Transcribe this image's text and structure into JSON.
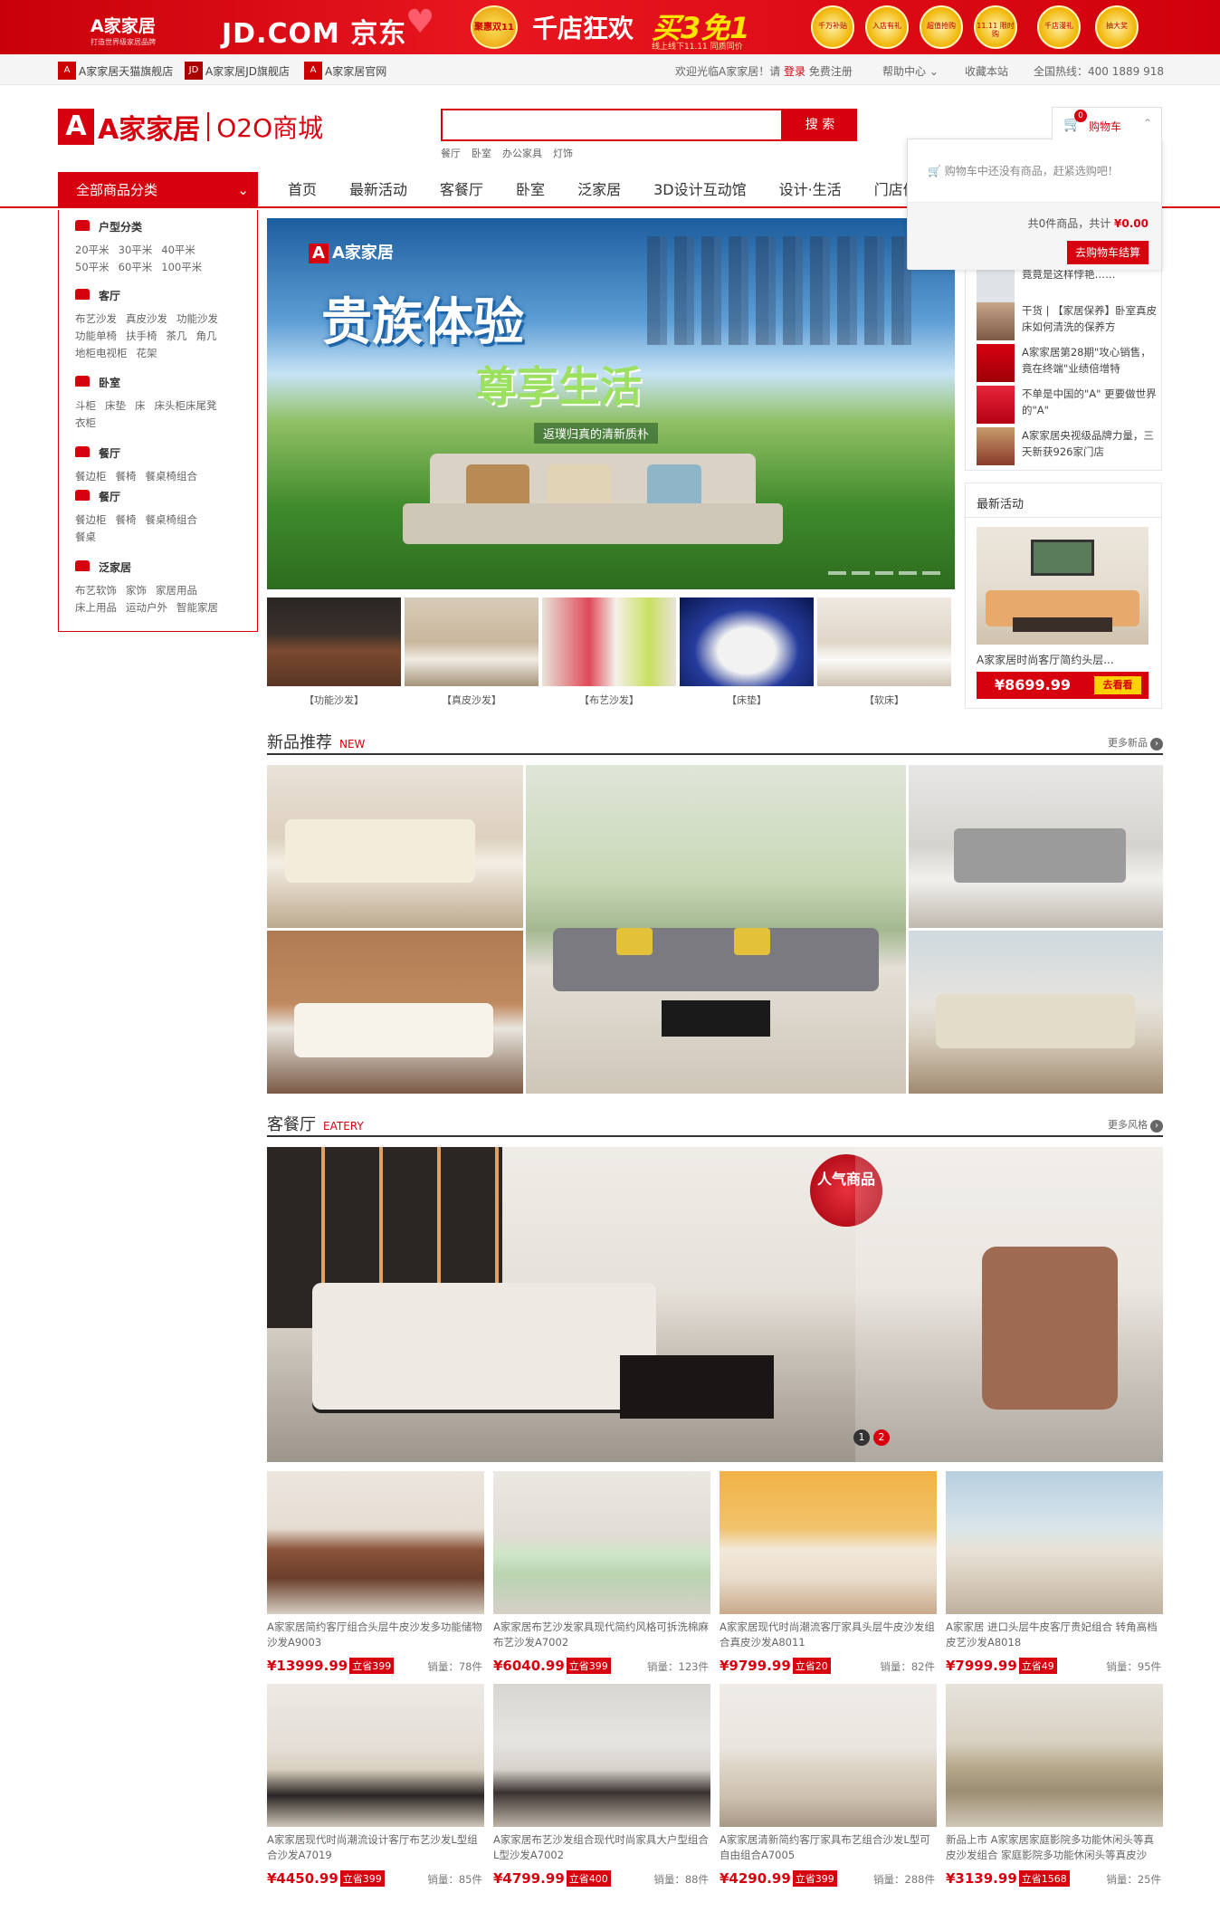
{
  "promo": {
    "brand": "A家家居",
    "brand_sub": "打造世界级家居品牌",
    "jd": "JD.COM 京东",
    "badge": "聚惠双11",
    "slogan1": "千店狂欢",
    "slogan2": "买3免1",
    "sub": "线上线下11.11 同质同价",
    "coins": [
      "千万补贴",
      "入店有礼",
      "超值抢购",
      "11.11 限时购",
      "千店漫礼",
      "抽大奖"
    ]
  },
  "util": {
    "shops": [
      "A家家居天猫旗舰店",
      "A家家居JD旗舰店",
      "A家家居官网"
    ],
    "welcome": "欢迎光临A家家居！请",
    "login": "登录",
    "register": "免费注册",
    "help": "帮助中心",
    "favorite": "收藏本站",
    "hotline": "全国热线：400 1889 918"
  },
  "header": {
    "logo_mark": "A",
    "logo_text": "A家家居",
    "logo_o2o": "O2O商城",
    "search_placeholder": "",
    "search_value": "",
    "search_button": "搜 索",
    "hot_words": [
      "餐厅",
      "卧室",
      "办公家具",
      "灯饰"
    ]
  },
  "cart": {
    "label": "购物车",
    "count": "0",
    "empty_msg": "购物车中还没有商品，赶紧选购吧！",
    "summary_prefix": "共0件商品，共计",
    "total": "¥0.00",
    "checkout": "去购物车结算"
  },
  "nav": {
    "category_toggle": "全部商品分类",
    "links": [
      "首页",
      "最新活动",
      "客餐厅",
      "卧室",
      "泛家居",
      "3D设计互动馆",
      "设计·生活",
      "门店体验馆"
    ]
  },
  "categories": [
    {
      "title": "户型分类",
      "items": [
        "20平米",
        "30平米",
        "40平米",
        "50平米",
        "60平米",
        "100平米"
      ]
    },
    {
      "title": "客厅",
      "items": [
        "布艺沙发",
        "真皮沙发",
        "功能沙发",
        "功能单椅",
        "扶手椅",
        "茶几",
        "角几",
        "地柜电视柜",
        "花架"
      ]
    },
    {
      "title": "卧室",
      "items": [
        "斗柜",
        "床垫",
        "床",
        "床头柜床尾凳",
        "衣柜"
      ]
    },
    {
      "title": "餐厅",
      "items": [
        "餐边柜",
        "餐椅",
        "餐桌椅组合"
      ]
    },
    {
      "title": "餐厅",
      "items": [
        "餐边柜",
        "餐椅",
        "餐桌椅组合",
        "餐桌"
      ]
    },
    {
      "title": "泛家居",
      "items": [
        "布艺软饰",
        "家饰",
        "家居用品",
        "床上用品",
        "运动户外",
        "智能家居"
      ]
    }
  ],
  "banner": {
    "brand": "A家家居",
    "headline": "贵族体验",
    "headline2": "尊享生活",
    "tagline": "返璞归真的清新质朴"
  },
  "thumbs": [
    "【功能沙发】",
    "【真皮沙发】",
    "【布艺沙发】",
    "【床垫】",
    "【软床】"
  ],
  "news": [
    "竟竟是这样悖艳……",
    "干货 | 【家居保养】卧室真皮床如何清洗的保养方",
    "A家家居第28期\"攻心销售，竟在终端\"业绩倍增特",
    "不单是中国的\"A\" 更要做世界的\"A\"",
    "A家家居央视级品牌力量，三天新获926家门店"
  ],
  "activity": {
    "title": "最新活动",
    "desc": "A家家居时尚客厅简约头层...",
    "price": "¥8699.99",
    "go": "去看看"
  },
  "section_new": {
    "title": "新品推荐",
    "en": "NEW",
    "more": "更多新品"
  },
  "section_eatery": {
    "title": "客餐厅",
    "en": "EATERY",
    "more": "更多风格",
    "badge": "人气商品",
    "pager": [
      "1",
      "2"
    ]
  },
  "products": [
    {
      "name": "A家家居简约客厅组合头层牛皮沙发多功能储物沙发A9003",
      "price": "¥13999.99",
      "save": "立省399",
      "sales_label": "销量：",
      "sales": "78",
      "unit": "件"
    },
    {
      "name": "A家家居布艺沙发家具现代简约风格可拆洗棉麻布艺沙发A7002",
      "price": "¥6040.99",
      "save": "立省399",
      "sales_label": "销量：",
      "sales": "123",
      "unit": "件"
    },
    {
      "name": "A家家居现代时尚潮流客厅家具头层牛皮沙发组合真皮沙发A8011",
      "price": "¥9799.99",
      "save": "立省20",
      "sales_label": "销量：",
      "sales": "82",
      "unit": "件"
    },
    {
      "name": "A家家居 进口头层牛皮客厅贵妃组合 转角高档皮艺沙发A8018",
      "price": "¥7999.99",
      "save": "立省49",
      "sales_label": "销量：",
      "sales": "95",
      "unit": "件"
    },
    {
      "name": "A家家居现代时尚潮流设计客厅布艺沙发L型组合沙发A7019",
      "price": "¥4450.99",
      "save": "立省399",
      "sales_label": "销量：",
      "sales": "85",
      "unit": "件"
    },
    {
      "name": "A家家居布艺沙发组合现代时尚家具大户型组合L型沙发A7002",
      "price": "¥4799.99",
      "save": "立省400",
      "sales_label": "销量：",
      "sales": "88",
      "unit": "件"
    },
    {
      "name": "A家家居清新简约客厅家具布艺组合沙发L型可自由组合A7005",
      "price": "¥4290.99",
      "save": "立省399",
      "sales_label": "销量：",
      "sales": "288",
      "unit": "件"
    },
    {
      "name": "新品上市 A家家居家庭影院多功能休闲头等真皮沙发组合 家庭影院多功能休闲头等真皮沙",
      "price": "¥3139.99",
      "save": "立省1568",
      "sales_label": "销量：",
      "sales": "25",
      "unit": "件"
    }
  ]
}
